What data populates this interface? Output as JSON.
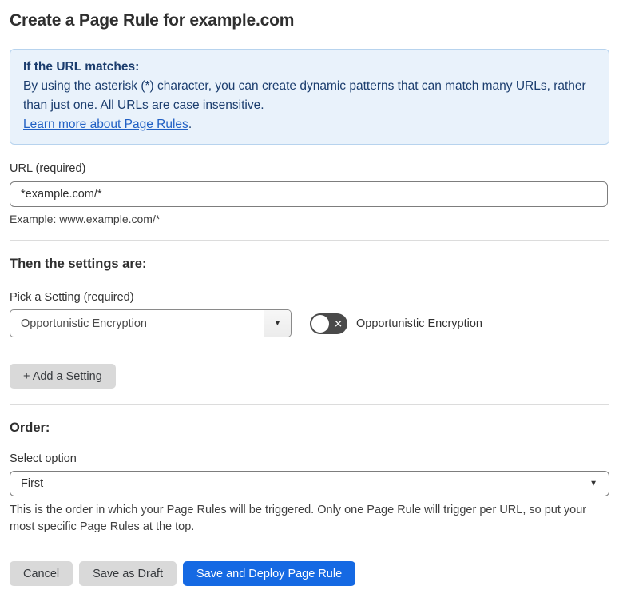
{
  "page": {
    "title": "Create a Page Rule for example.com"
  },
  "info_box": {
    "heading": "If the URL matches:",
    "body": "By using the asterisk (*) character, you can create dynamic patterns that can match many URLs, rather than just one. All URLs are case insensitive.",
    "link_label": "Learn more about Page Rules",
    "link_suffix": "."
  },
  "url_field": {
    "label": "URL (required)",
    "value": "*example.com/*",
    "example": "Example: www.example.com/*"
  },
  "settings_section": {
    "heading": "Then the settings are:",
    "picker_label": "Pick a Setting (required)",
    "selected_setting": "Opportunistic Encryption",
    "toggle": {
      "state": "off",
      "off_glyph": "✕",
      "label": "Opportunistic Encryption"
    },
    "add_setting_label": "+ Add a Setting"
  },
  "order_section": {
    "heading": "Order:",
    "select_label": "Select option",
    "selected_option": "First",
    "help_text": "This is the order in which your Page Rules will be triggered. Only one Page Rule will trigger per URL, so put your most specific Page Rules at the top."
  },
  "actions": {
    "cancel_label": "Cancel",
    "save_draft_label": "Save as Draft",
    "save_deploy_label": "Save and Deploy Page Rule"
  },
  "icons": {
    "dropdown_arrow": "▼",
    "select_chevron": "▼"
  },
  "colors": {
    "accent_blue": "#1569e3",
    "info_background": "#e9f2fb",
    "info_border": "#b7d3ee",
    "info_text": "#1b3d6e",
    "link_blue": "#2160c4",
    "toggle_off_background": "#4a4a4a",
    "button_gray": "#d9d9d9"
  }
}
